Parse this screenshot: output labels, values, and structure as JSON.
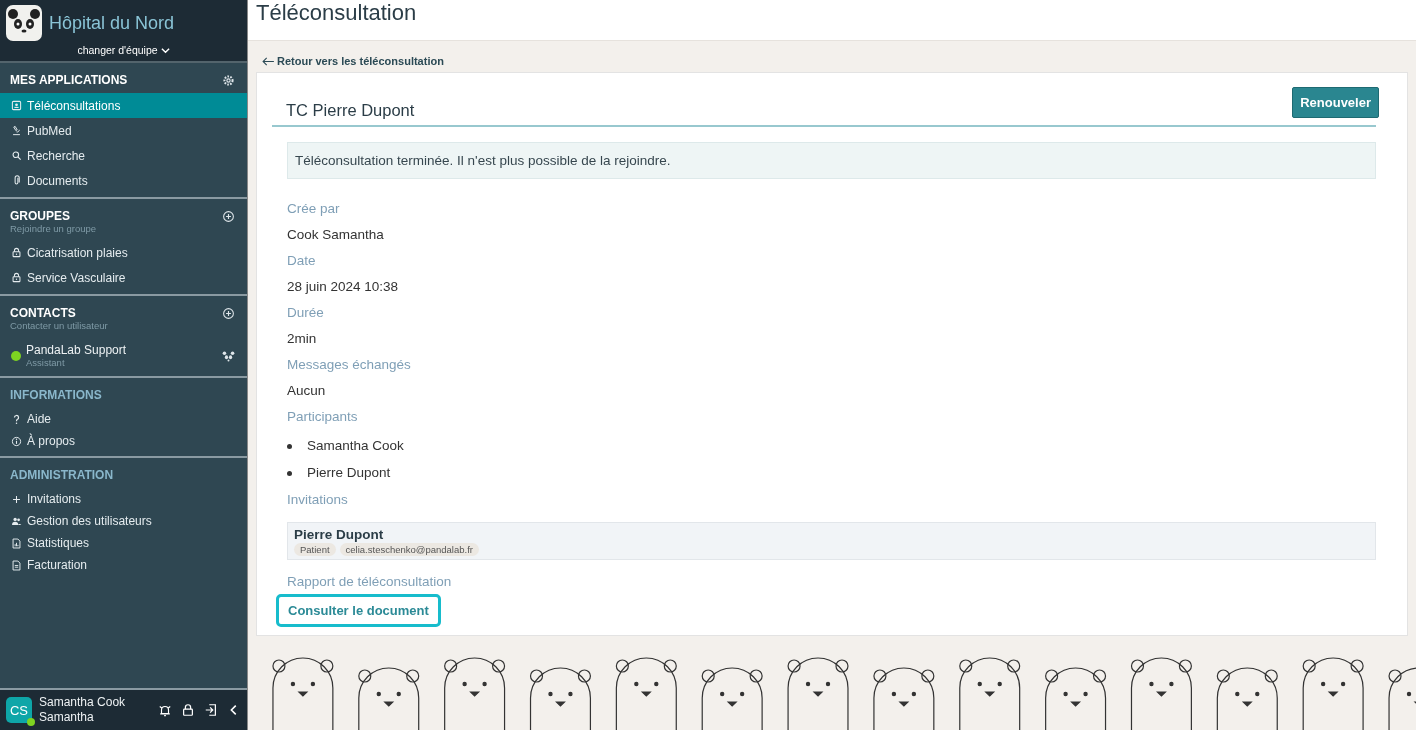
{
  "sidebar": {
    "team_name": "Hôpital du Nord",
    "team_switch": "changer d'équipe",
    "sections": [
      {
        "kind": "apps",
        "title": "MES APPLICATIONS",
        "items": [
          {
            "label": "Téléconsultations",
            "selected": true
          },
          {
            "label": "PubMed",
            "selected": false
          },
          {
            "label": "Recherche",
            "selected": false
          },
          {
            "label": "Documents",
            "selected": false
          }
        ]
      },
      {
        "kind": "groups",
        "title": "GROUPES",
        "subtitle": "Rejoindre un groupe",
        "items": [
          {
            "label": "Cicatrisation plaies",
            "selected": false
          },
          {
            "label": "Service Vasculaire",
            "selected": false
          }
        ]
      },
      {
        "kind": "contacts",
        "title": "CONTACTS",
        "subtitle": "Contacter un utilisateur",
        "contacts": [
          {
            "name": "PandaLab Support",
            "role": "Assistant",
            "color": "#7ed321"
          }
        ]
      },
      {
        "kind": "info",
        "title": "INFORMATIONS",
        "items": [
          {
            "label": "Aide",
            "selected": false
          },
          {
            "label": "À propos",
            "selected": false
          }
        ]
      },
      {
        "kind": "admin",
        "title": "ADMINISTRATION",
        "items": [
          {
            "label": "Invitations",
            "selected": false
          },
          {
            "label": "Gestion des utilisateurs",
            "selected": false
          },
          {
            "label": "Statistiques",
            "selected": false
          },
          {
            "label": "Facturation",
            "selected": false
          }
        ]
      }
    ],
    "user": {
      "initials": "CS",
      "name": "Samantha Cook",
      "subname": "Samantha",
      "online": true
    }
  },
  "page_title": "Téléconsultation",
  "back_link": "Retour vers les téléconsultation",
  "card": {
    "title": "TC Pierre Dupont",
    "renew_button": "Renouveler",
    "notice": "Téléconsultation terminée. Il n'est plus possible de la rejoindre.",
    "fields": [
      {
        "label": "Crée par",
        "value": "Cook Samantha"
      },
      {
        "label": "Date",
        "value": "28 juin 2024 10:38"
      },
      {
        "label": "Durée",
        "value": "2min"
      },
      {
        "label": "Messages échangés",
        "value": "Aucun"
      }
    ],
    "participants_label": "Participants",
    "participants": [
      "Samantha Cook",
      "Pierre Dupont"
    ],
    "invitations_label": "Invitations",
    "invitations": [
      {
        "name": "Pierre Dupont",
        "tags": [
          "Patient",
          "celia.steschenko@pandalab.fr"
        ]
      }
    ],
    "report_label": "Rapport de téléconsultation",
    "report_link": {
      "label": "Consulter le document",
      "focused": true
    }
  }
}
